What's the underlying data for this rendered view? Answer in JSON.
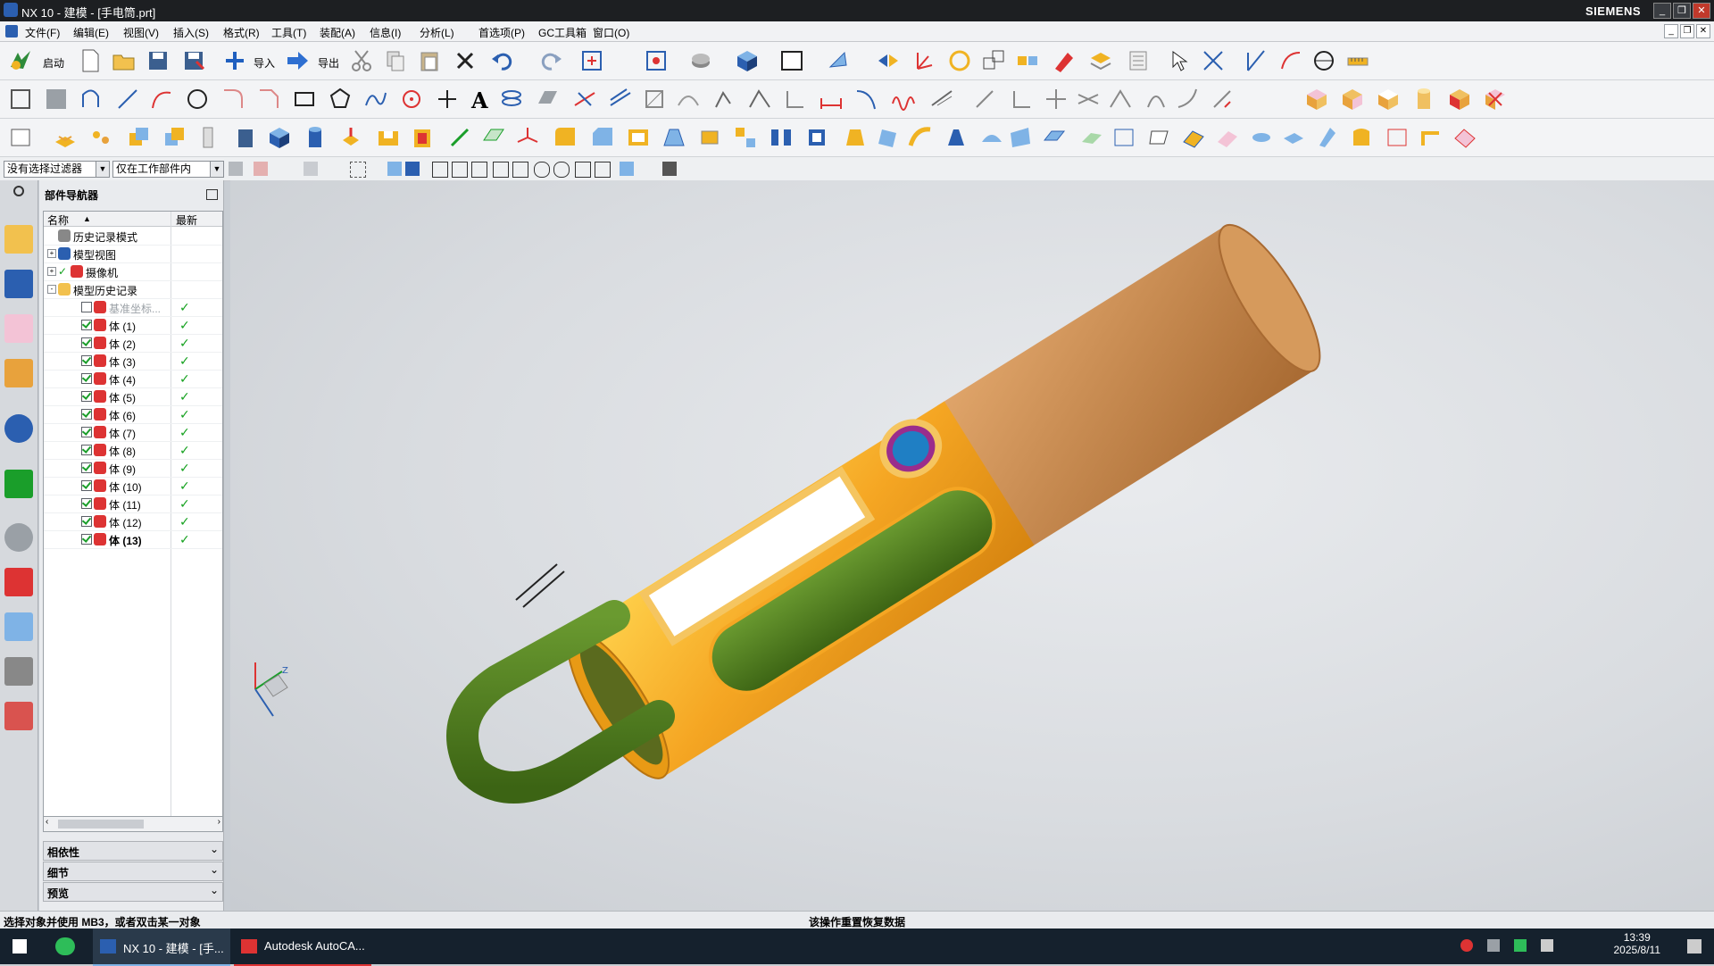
{
  "window": {
    "title": "NX 10 - 建模 - [手电筒.prt]",
    "brand": "SIEMENS"
  },
  "menu": [
    "文件(F)",
    "编辑(E)",
    "视图(V)",
    "插入(S)",
    "格式(R)",
    "工具(T)",
    "装配(A)",
    "信息(I)",
    "分析(L)",
    "首选项(P)",
    "GC工具箱",
    "窗口(O)"
  ],
  "toolbar": {
    "start_label": "启动",
    "import_label": "导入",
    "export_label": "导出"
  },
  "filter": {
    "type_filter": "没有选择过滤器",
    "scope_filter": "仅在工作部件内"
  },
  "navigator": {
    "title": "部件导航器",
    "col_name": "名称",
    "col_latest": "最新",
    "nodes": [
      {
        "label": "历史记录模式",
        "indent": 0,
        "expander": "",
        "icon": "clock-icon",
        "checkbox": "none",
        "latest": false
      },
      {
        "label": "模型视图",
        "indent": 0,
        "expander": "+",
        "icon": "views-icon",
        "checkbox": "none",
        "latest": false
      },
      {
        "label": "摄像机",
        "indent": 0,
        "expander": "+",
        "icon": "camera-icon",
        "checkbox": "tick",
        "latest": false
      },
      {
        "label": "模型历史记录",
        "indent": 0,
        "expander": "-",
        "icon": "folder-icon",
        "checkbox": "none",
        "latest": false
      },
      {
        "label": "基准坐标...",
        "indent": 1,
        "expander": "",
        "icon": "datum-csys-icon",
        "checkbox": "off",
        "latest": true,
        "dim": true
      },
      {
        "label": "体 (1)",
        "indent": 1,
        "expander": "",
        "icon": "body-icon",
        "checkbox": "on",
        "latest": true
      },
      {
        "label": "体 (2)",
        "indent": 1,
        "expander": "",
        "icon": "body-icon",
        "checkbox": "on",
        "latest": true
      },
      {
        "label": "体 (3)",
        "indent": 1,
        "expander": "",
        "icon": "body-icon",
        "checkbox": "on",
        "latest": true
      },
      {
        "label": "体 (4)",
        "indent": 1,
        "expander": "",
        "icon": "body-icon",
        "checkbox": "on",
        "latest": true
      },
      {
        "label": "体 (5)",
        "indent": 1,
        "expander": "",
        "icon": "body-icon",
        "checkbox": "on",
        "latest": true
      },
      {
        "label": "体 (6)",
        "indent": 1,
        "expander": "",
        "icon": "body-icon",
        "checkbox": "on",
        "latest": true
      },
      {
        "label": "体 (7)",
        "indent": 1,
        "expander": "",
        "icon": "body-icon",
        "checkbox": "on",
        "latest": true
      },
      {
        "label": "体 (8)",
        "indent": 1,
        "expander": "",
        "icon": "body-icon",
        "checkbox": "on",
        "latest": true
      },
      {
        "label": "体 (9)",
        "indent": 1,
        "expander": "",
        "icon": "body-icon",
        "checkbox": "on",
        "latest": true
      },
      {
        "label": "体 (10)",
        "indent": 1,
        "expander": "",
        "icon": "body-icon",
        "checkbox": "on",
        "latest": true
      },
      {
        "label": "体 (11)",
        "indent": 1,
        "expander": "",
        "icon": "body-icon",
        "checkbox": "on",
        "latest": true
      },
      {
        "label": "体 (12)",
        "indent": 1,
        "expander": "",
        "icon": "body-icon",
        "checkbox": "on",
        "latest": true
      },
      {
        "label": "体 (13)",
        "indent": 1,
        "expander": "",
        "icon": "body-icon",
        "checkbox": "on",
        "latest": true,
        "bold": true
      }
    ],
    "panels": [
      "相依性",
      "细节",
      "预览"
    ]
  },
  "status": {
    "prompt": "选择对象并使用 MB3，或者双击某一对象",
    "message": "该操作重置恢复数据"
  },
  "taskbar": {
    "tasks": [
      "NX 10 - 建模 - [手...",
      "Autodesk AutoCA..."
    ],
    "time": "13:39",
    "date": "2025/8/11"
  },
  "colors": {
    "body_orange": "#f5a623",
    "cap_brown": "#c8874a",
    "grip_green": "#4c7a1e",
    "button_blue": "#1f7fc4",
    "button_ring": "#9a2d8c"
  }
}
